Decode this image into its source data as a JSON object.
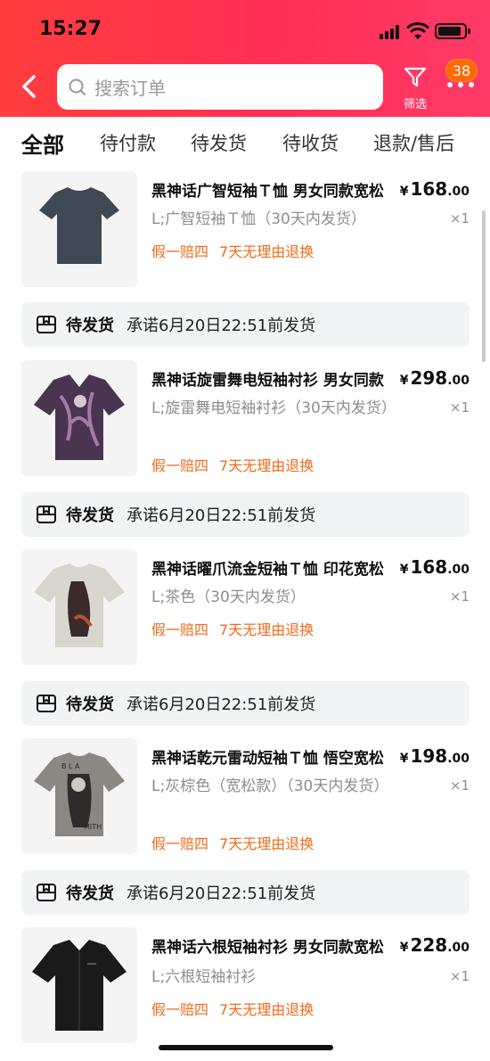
{
  "status_bar": {
    "time": "15:27"
  },
  "header": {
    "search_placeholder": "搜索订单",
    "filter_label": "筛选",
    "badge_count": "38"
  },
  "tabs": [
    {
      "label": "全部",
      "active": true
    },
    {
      "label": "待付款"
    },
    {
      "label": "待发货"
    },
    {
      "label": "待收货"
    },
    {
      "label": "退款/售后"
    }
  ],
  "tags": {
    "tag1": "假一赔四",
    "tag2": "7天无理由退换"
  },
  "orders": [
    {
      "title": "黑神话广智短袖Ｔ恤 男女同款宽松",
      "price_int": "168",
      "price_dec": ".00",
      "spec": "L;广智短袖Ｔ恤（30天内发货）",
      "qty": "×1",
      "image": "dark-grey-tshirt",
      "shipping": {
        "status": "待发货",
        "promise": "承诺6月20日22:51前发货"
      }
    },
    {
      "title": "黑神话旋雷舞电短袖衬衫 男女同款",
      "price_int": "298",
      "price_dec": ".00",
      "spec": "L;旋雷舞电短袖衬衫（30天内发货）",
      "qty": "×1",
      "image": "purple-print-shirt",
      "shipping": {
        "status": "待发货",
        "promise": "承诺6月20日22:51前发货"
      }
    },
    {
      "title": "黑神话曜爪流金短袖Ｔ恤 印花宽松",
      "price_int": "168",
      "price_dec": ".00",
      "spec": "L;茶色（30天内发货）",
      "qty": "×1",
      "image": "beige-print-tshirt",
      "shipping": {
        "status": "待发货",
        "promise": "承诺6月20日22:51前发货"
      }
    },
    {
      "title": "黑神话乾元雷动短袖Ｔ恤 悟空宽松",
      "price_int": "198",
      "price_dec": ".00",
      "spec": "L;灰棕色（宽松款）（30天内发货）",
      "qty": "×1",
      "image": "grey-brown-print-tshirt",
      "shipping": {
        "status": "待发货",
        "promise": "承诺6月20日22:51前发货"
      }
    },
    {
      "title": "黑神话六根短袖衬衫 男女同款宽松",
      "price_int": "228",
      "price_dec": ".00",
      "spec": "L;六根短袖衬衫",
      "qty": "×1",
      "image": "black-shirt"
    }
  ],
  "colors": {
    "header_start": "#ff3d3d",
    "header_end": "#ff3a66",
    "tag_orange": "#f06a1b",
    "badge": "#ff6a00"
  }
}
